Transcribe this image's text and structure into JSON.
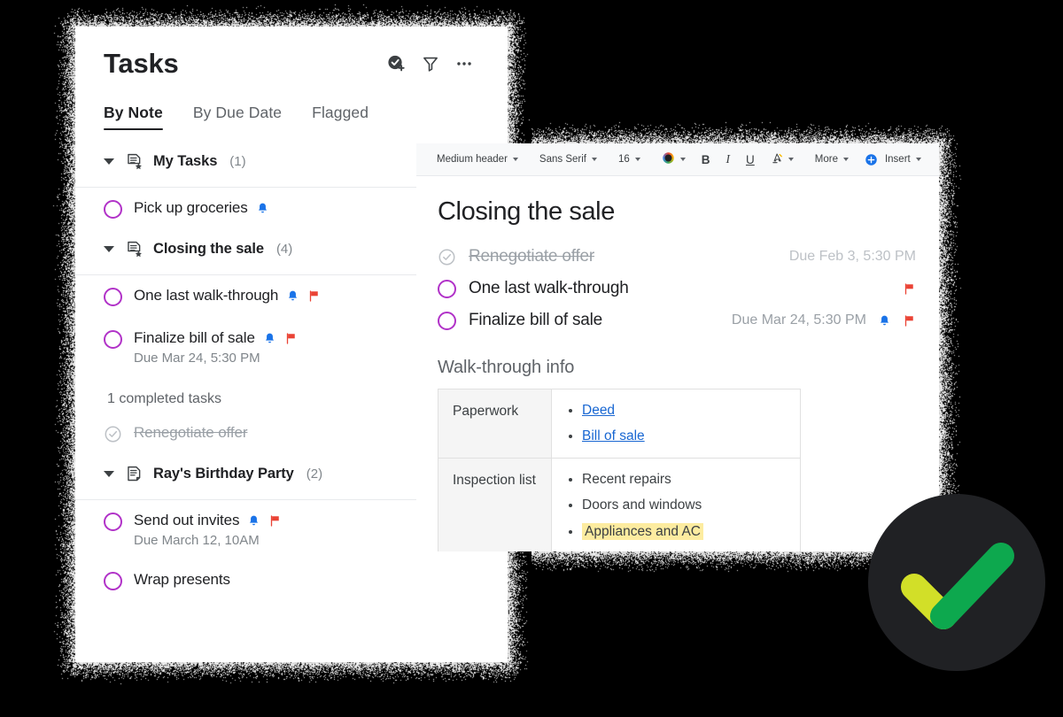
{
  "colors": {
    "background": "#000000",
    "panel": "#ffffff",
    "accent_checkbox": "#b132c8",
    "bell": "#1a73e8",
    "flag": "#ea4335",
    "link": "#1967d2",
    "highlight": "#fdeca0",
    "badge_circle": "#202124",
    "check_green": "#0da84e",
    "check_lime": "#d2df28",
    "insert_blue": "#1a73e8"
  },
  "tasks_panel": {
    "title": "Tasks",
    "header_icons": [
      {
        "name": "add-task-icon",
        "label": "Add task"
      },
      {
        "name": "filter-icon",
        "label": "Filter"
      },
      {
        "name": "more-options-icon",
        "label": "More options"
      }
    ],
    "tabs": [
      {
        "label": "By Note",
        "active": true
      },
      {
        "label": "By Due Date",
        "active": false
      },
      {
        "label": "Flagged",
        "active": false
      }
    ],
    "groups": [
      {
        "icon": "note-starred-icon",
        "label": "My Tasks",
        "count": "(1)",
        "tasks": [
          {
            "text": "Pick up groceries",
            "done": false,
            "due": "",
            "bell": true,
            "flag": false
          }
        ],
        "completed_header": "",
        "completed": []
      },
      {
        "icon": "note-starred-icon",
        "label": "Closing the sale",
        "count": "(4)",
        "tasks": [
          {
            "text": "One last walk-through",
            "done": false,
            "due": "",
            "bell": true,
            "flag": true
          },
          {
            "text": "Finalize bill of sale",
            "done": false,
            "due": "Due Mar 24, 5:30 PM",
            "bell": true,
            "flag": true
          }
        ],
        "completed_header": "1 completed tasks",
        "completed": [
          {
            "text": "Renegotiate offer",
            "done": true,
            "due": "",
            "bell": false,
            "flag": false
          }
        ]
      },
      {
        "icon": "note-icon",
        "label": "Ray's Birthday Party",
        "count": "(2)",
        "tasks": [
          {
            "text": "Send out invites",
            "done": false,
            "due": "Due March 12, 10AM",
            "bell": true,
            "flag": true
          },
          {
            "text": "Wrap presents",
            "done": false,
            "due": "",
            "bell": false,
            "flag": false
          }
        ],
        "completed_header": "",
        "completed": []
      }
    ]
  },
  "editor_panel": {
    "toolbar": {
      "style_label": "Medium header",
      "font_label": "Sans Serif",
      "size_label": "16",
      "color_label": "",
      "bold_label": "B",
      "italic_label": "I",
      "underline_label": "U",
      "highlight_label": "A",
      "more_label": "More",
      "insert_label": "Insert"
    },
    "doc_title": "Closing the sale",
    "tasks": [
      {
        "text": "Renegotiate offer",
        "done": true,
        "due": "Due Feb 3, 5:30 PM",
        "bell": false,
        "flag": false
      },
      {
        "text": "One last walk-through",
        "done": false,
        "due": "",
        "bell": false,
        "flag": true
      },
      {
        "text": "Finalize bill of sale",
        "done": false,
        "due": "Due Mar 24, 5:30 PM",
        "bell": true,
        "flag": true
      }
    ],
    "section_title": "Walk-through info",
    "table": [
      {
        "label": "Paperwork",
        "items": [
          {
            "text": "Deed",
            "link": true,
            "highlight": false
          },
          {
            "text": "Bill of sale",
            "link": true,
            "highlight": false
          }
        ]
      },
      {
        "label": "Inspection list",
        "items": [
          {
            "text": "Recent repairs",
            "link": false,
            "highlight": false
          },
          {
            "text": "Doors and windows",
            "link": false,
            "highlight": false
          },
          {
            "text": "Appliances and AC",
            "link": false,
            "highlight": true
          }
        ]
      }
    ]
  },
  "badge": {
    "name": "checkmark-badge",
    "label": "Tasks complete"
  }
}
